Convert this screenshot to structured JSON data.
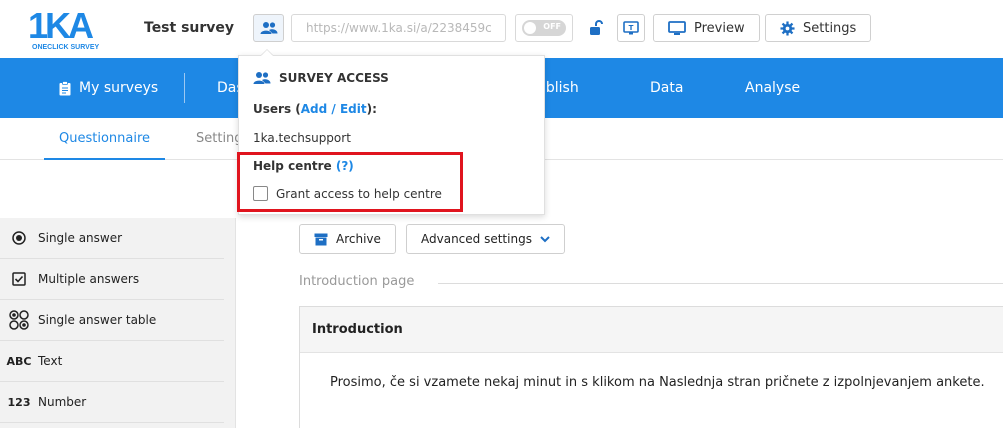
{
  "header": {
    "logo_mark": "1KA",
    "logo_sub": "ONECLICK SURVEY",
    "survey_title": "Test survey",
    "survey_url": "https://www.1ka.si/a/2238459c",
    "toggle_label": "OFF",
    "preview_label": "Preview",
    "settings_label": "Settings"
  },
  "nav": {
    "items": [
      "My surveys",
      "Das",
      "ublish",
      "Data",
      "Analyse"
    ]
  },
  "subtabs": {
    "questionnaire": "Questionnaire",
    "settings": "Setting"
  },
  "palette": {
    "items": [
      {
        "icon": "radio-icon",
        "label": "Single answer"
      },
      {
        "icon": "checkbox-icon",
        "label": "Multiple answers"
      },
      {
        "icon": "grid-icon",
        "label": "Single answer table"
      },
      {
        "icon_text": "ABC",
        "icon": "text-icon",
        "label": "Text"
      },
      {
        "icon_text": "123",
        "icon": "number-icon",
        "label": "Number"
      }
    ]
  },
  "toolbar": {
    "archive_label": "Archive",
    "advanced_label": "Advanced settings"
  },
  "intro": {
    "section_label": "Introduction page",
    "card_title": "Introduction",
    "card_text": "Prosimo, če si vzamete nekaj minut in s klikom na Naslednja stran pričnete z izpolnjevanjem ankete."
  },
  "popup": {
    "title": "SURVEY ACCESS",
    "users_label": "Users (",
    "users_link": "Add / Edit",
    "users_suffix": "):",
    "user_name": "1ka.techsupport",
    "help_label": "Help centre ",
    "help_link": "(?)",
    "grant_label": "Grant access to help centre",
    "grant_checked": false
  },
  "colors": {
    "brand_blue": "#1e88e5",
    "highlight_red": "#e0141e"
  }
}
